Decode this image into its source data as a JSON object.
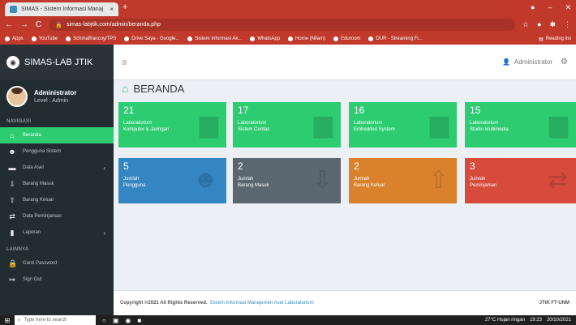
{
  "browser": {
    "tab_title": "SIMAS - Sistem Informasi Manaj",
    "tab_close": "×",
    "new_tab": "+",
    "url": "simas-labjtik.com/admin/beranda.php",
    "back": "←",
    "forward": "→",
    "reload": "C",
    "bookmarks": [
      "Apps",
      "YouTube",
      "Schmalfrancoy/TPS",
      "Drive Saya - Google...",
      "Sistem Informasi Ak...",
      "WhatsApp",
      "Home (Nilam)",
      "Eduroom",
      "DUR - Streaming Fi..."
    ],
    "reading_list": "Reading list"
  },
  "app": {
    "logo_text": "SIMAS-LAB JTIK",
    "topbar": {
      "user": "Administrator"
    }
  },
  "profile": {
    "name": "Administrator",
    "level": "Level : Admin"
  },
  "sidebar": {
    "section_nav": "NAVIGASI",
    "section_other": "LAINNYA",
    "items": [
      {
        "label": "Beranda",
        "icon": "home-icon"
      },
      {
        "label": "Pengguna Sistem",
        "icon": "users-icon"
      },
      {
        "label": "Data Aset",
        "icon": "database-icon"
      },
      {
        "label": "Barang Masuk",
        "icon": "inbox-icon"
      },
      {
        "label": "Barang Keluar",
        "icon": "outbox-icon"
      },
      {
        "label": "Data Peminjaman",
        "icon": "exchange-icon"
      },
      {
        "label": "Laporan",
        "icon": "report-icon"
      }
    ],
    "other_items": [
      {
        "label": "Ganti Password",
        "icon": "lock-icon"
      },
      {
        "label": "Sign Out",
        "icon": "signout-icon"
      }
    ]
  },
  "page": {
    "title": "BERANDA"
  },
  "boxes": [
    {
      "num": "21",
      "l1": "Laboratorium",
      "l2": "Komputer & Jaringan",
      "color": "#2ecc71"
    },
    {
      "num": "17",
      "l1": "Laboratorium",
      "l2": "Sistem Cerdas",
      "color": "#2ecc71"
    },
    {
      "num": "16",
      "l1": "Laboratorium",
      "l2": "Embedded System",
      "color": "#2ecc71"
    },
    {
      "num": "15",
      "l1": "Laboratorium",
      "l2": "Studio Multimedia",
      "color": "#2ecc71"
    },
    {
      "num": "5",
      "l1": "Jumlah",
      "l2": "Pengguna",
      "color": "#3486c2"
    },
    {
      "num": "2",
      "l1": "Jumlah",
      "l2": "Barang Masuk",
      "color": "#5a6770"
    },
    {
      "num": "2",
      "l1": "Jumlah",
      "l2": "Barang Keluar",
      "color": "#d9822b"
    },
    {
      "num": "3",
      "l1": "Jumlah",
      "l2": "Peminjaman",
      "color": "#d64b3c"
    }
  ],
  "footer": {
    "copyright": "Copyright ©2021 All Rights Reserved.",
    "system": "Sistem Informasi Manajemen Aset Laboratorium",
    "right": "JTIK FT-UNM"
  },
  "taskbar": {
    "search": "Type here to search",
    "weather": "27°C Hujan ringan",
    "time": "19:23",
    "date": "20/10/2021"
  }
}
